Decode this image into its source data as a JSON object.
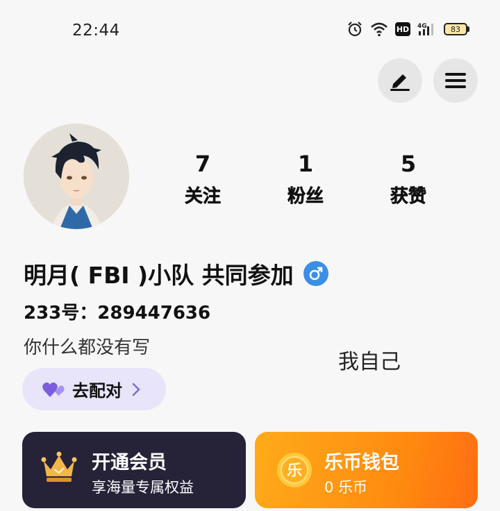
{
  "status_bar": {
    "time": "22:44",
    "hd_label": "HD",
    "network_label": "4G",
    "battery_level": "83"
  },
  "header": {
    "icons": [
      "edit-icon",
      "menu-icon"
    ]
  },
  "profile": {
    "stats": [
      {
        "value": "7",
        "label": "关注"
      },
      {
        "value": "1",
        "label": "粉丝"
      },
      {
        "value": "5",
        "label": "获赞"
      }
    ],
    "name": "明月( FBI )小队 共同参加",
    "gender_symbol": "♂",
    "user_id": "233号：289447636",
    "bio": "你什么都没有写",
    "self_label": "我自己",
    "match_button": "去配对"
  },
  "cards": {
    "vip": {
      "title": "开通会员",
      "subtitle": "享海量专属权益"
    },
    "wallet": {
      "title": "乐币钱包",
      "subtitle": "0 乐币",
      "coin_glyph": "乐"
    }
  },
  "colors": {
    "vip_bg": "#262238",
    "wallet_bg": "#ff8a10",
    "gender_badge": "#3a8ee6",
    "match_bg": "#e8e5fa",
    "heart": "#7b5de0"
  }
}
